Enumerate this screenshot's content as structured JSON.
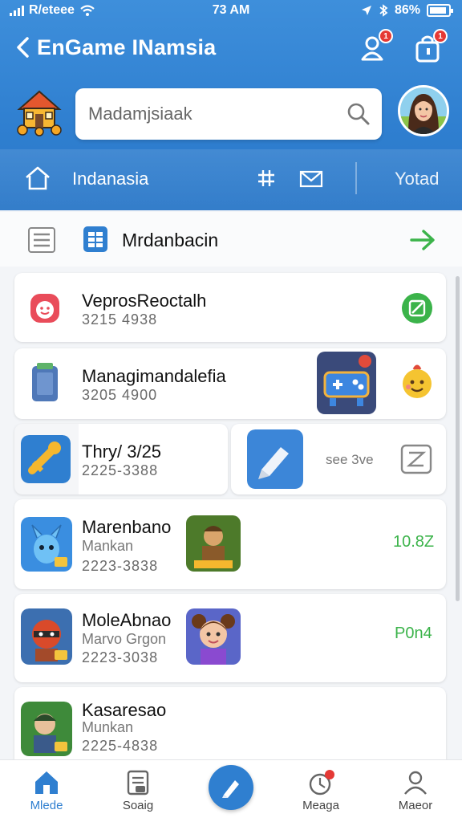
{
  "status_bar": {
    "carrier": "R/eteee",
    "time": "73 AM",
    "battery": "86%"
  },
  "header": {
    "title": "EnGame INamsia",
    "search_placeholder": "Madamjsiaak",
    "badge_count": "1"
  },
  "tabs": {
    "active_label": "Indanasia",
    "total_label": "Yotad"
  },
  "section": {
    "title": "Mrdanbacin"
  },
  "items": [
    {
      "title": "VeprosReoctalh",
      "number": "3215 4938"
    },
    {
      "title": "Managimandalefia",
      "number": "3205 4900"
    },
    {
      "title": "Thry/ 3/25",
      "number": "2225-3388",
      "extra": "see 3ve"
    },
    {
      "title": "Marenbano",
      "subtitle": "Mankan",
      "number": "2223-3838",
      "value": "10.8Z"
    },
    {
      "title": "MoleAbnao",
      "subtitle": "Marvo Grgon",
      "number": "2223-3038",
      "value": "P0n4"
    },
    {
      "title": "Kasaresao",
      "subtitle": "Munkan",
      "number": "2225-4838"
    }
  ],
  "bottom_nav": [
    {
      "label": "Mlede",
      "icon": "home-icon"
    },
    {
      "label": "Soaig",
      "icon": "document-icon"
    },
    {
      "label": "",
      "icon": "compose-icon"
    },
    {
      "label": "Meaga",
      "icon": "notification-icon"
    },
    {
      "label": "Maeor",
      "icon": "profile-icon"
    }
  ],
  "colors": {
    "header_blue": "#2f7fd0",
    "accent_green": "#3bb34a",
    "badge_red": "#e53935"
  }
}
